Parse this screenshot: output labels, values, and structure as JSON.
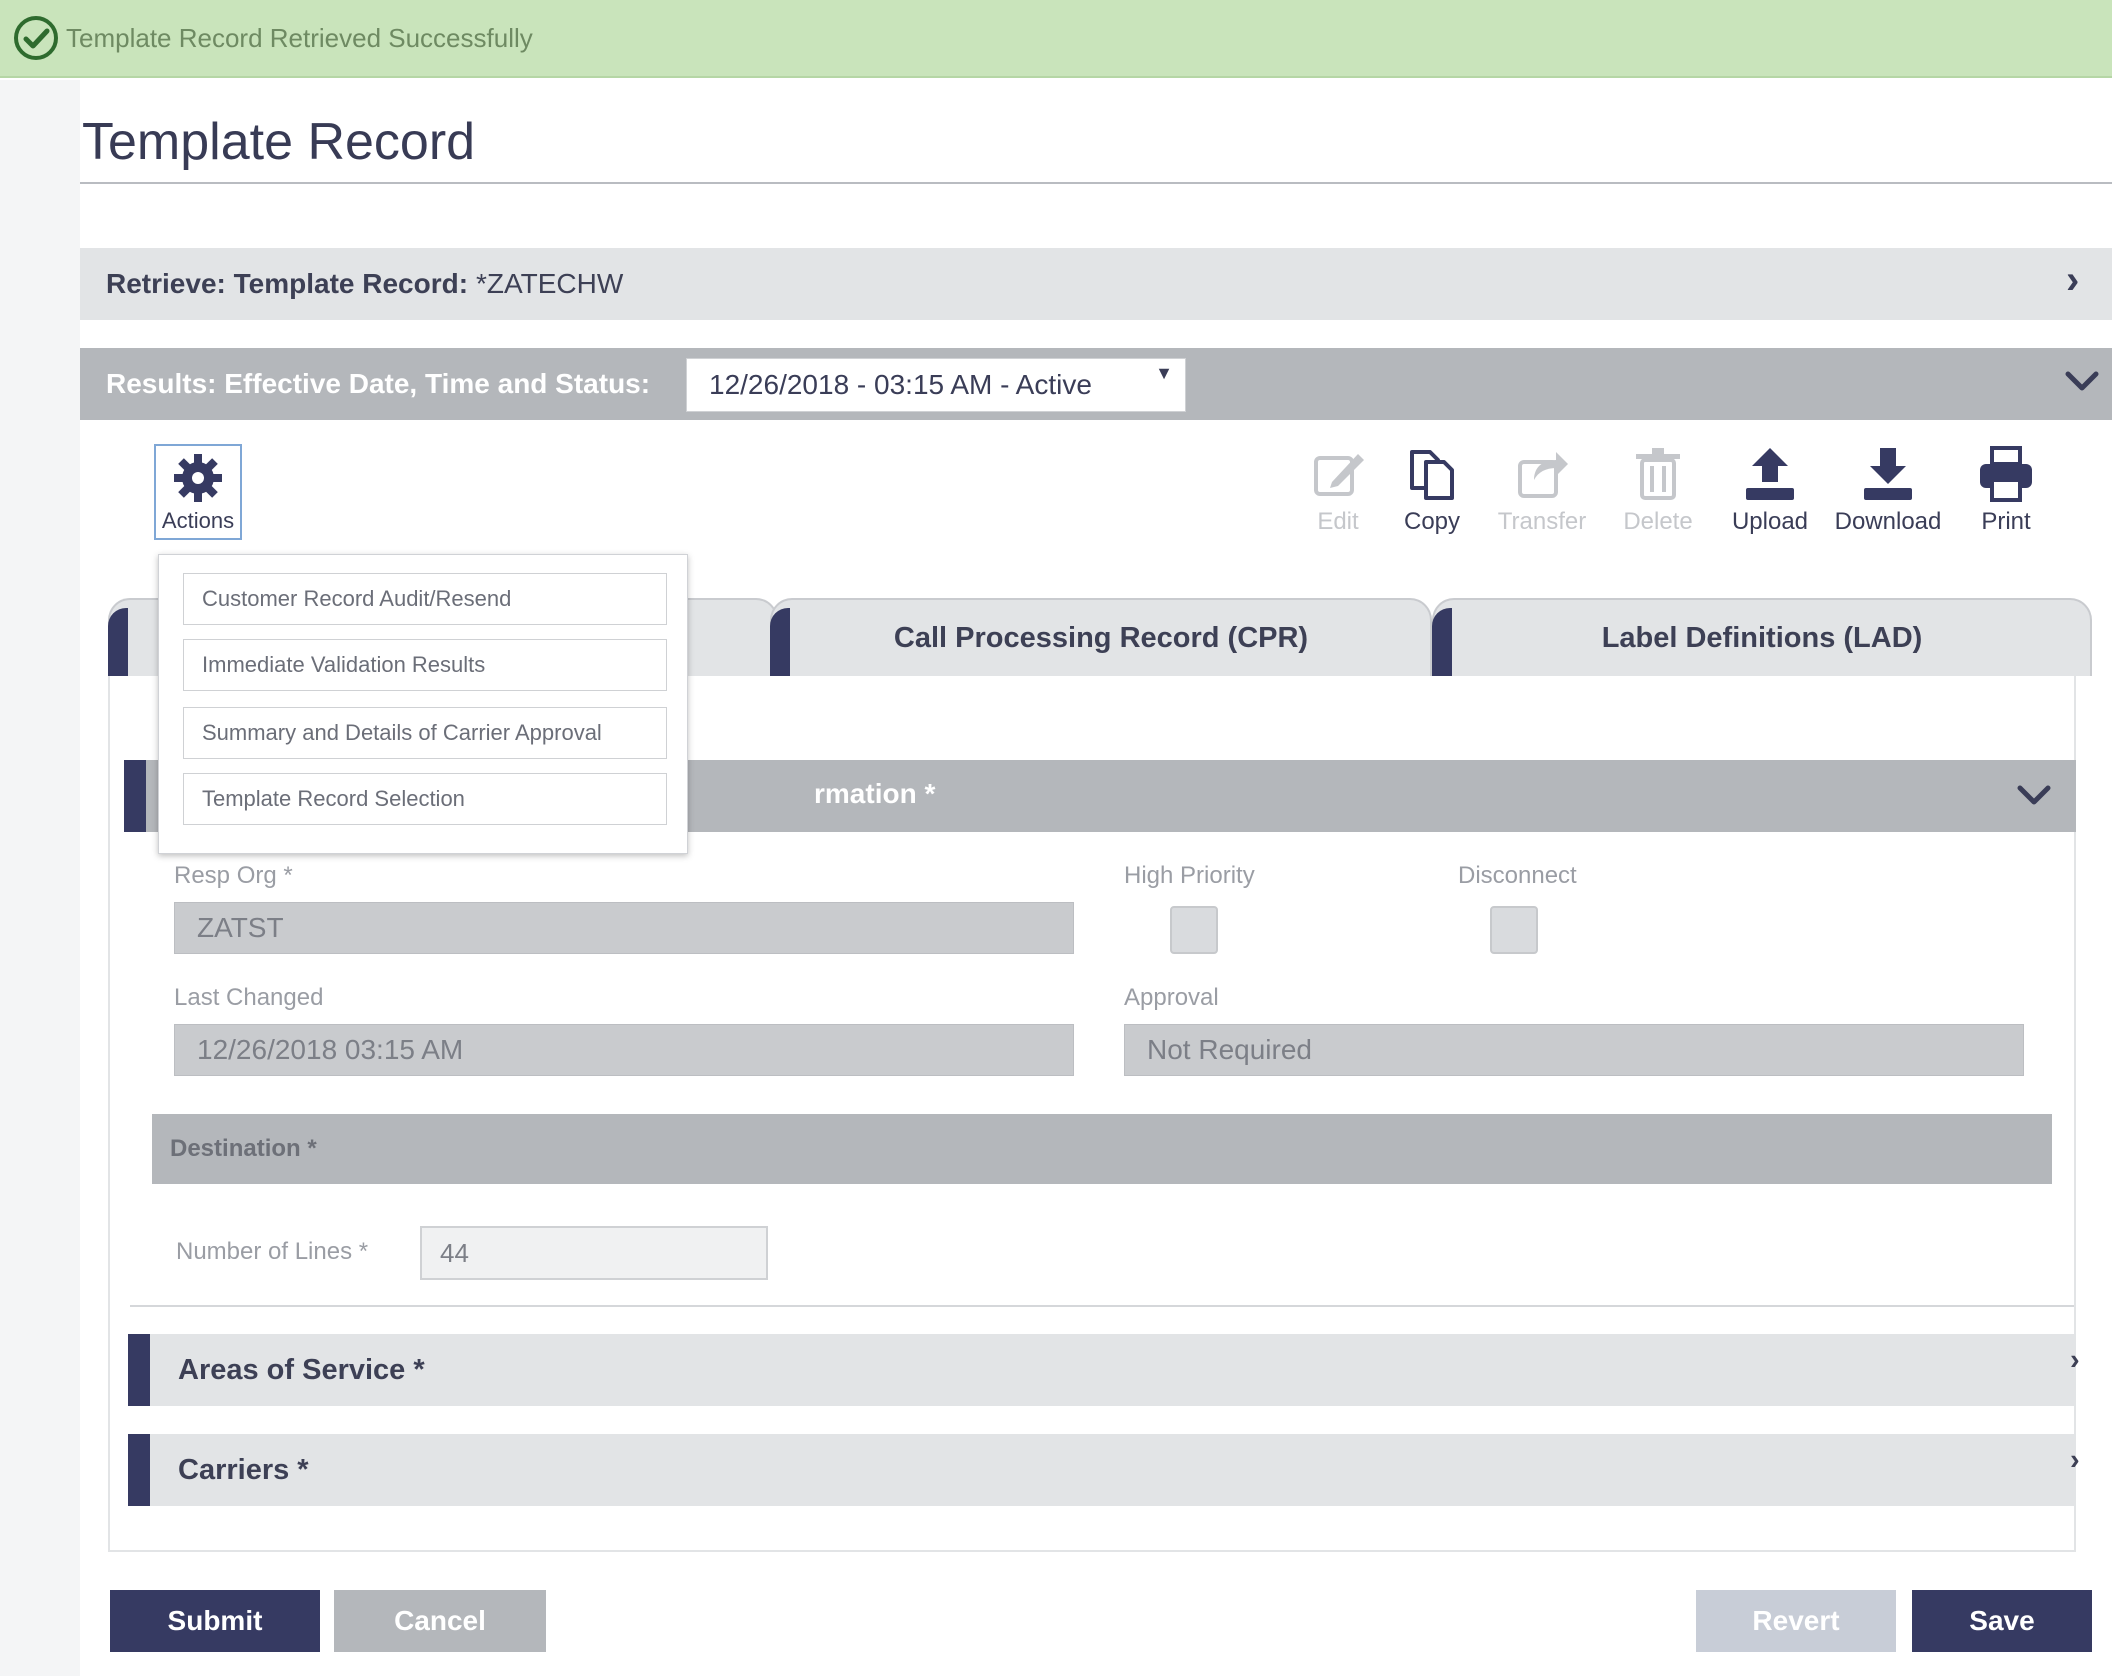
{
  "banner": {
    "message": "Template Record Retrieved Successfully"
  },
  "page": {
    "title": "Template Record"
  },
  "retrieve": {
    "label": "Retrieve: Template Record:",
    "value": "*ZATECHW"
  },
  "results": {
    "label": "Results: Effective Date, Time and Status:",
    "selected": "12/26/2018 - 03:15 AM - Active"
  },
  "actions": {
    "label": "Actions",
    "menu": [
      "Customer Record Audit/Resend",
      "Immediate Validation Results",
      "Summary and Details of Carrier Approval",
      "Template Record Selection"
    ]
  },
  "toolbar": {
    "edit": "Edit",
    "copy": "Copy",
    "transfer": "Transfer",
    "delete": "Delete",
    "upload": "Upload",
    "download": "Download",
    "print": "Print"
  },
  "tabs": {
    "cpr": "Call Processing Record (CPR)",
    "lad": "Label Definitions (LAD)"
  },
  "section": {
    "title_fragment": "rmation *"
  },
  "fields": {
    "resp_org_label": "Resp Org *",
    "resp_org_value": "ZATST",
    "high_priority_label": "High Priority",
    "disconnect_label": "Disconnect",
    "last_changed_label": "Last Changed",
    "last_changed_value": "12/26/2018 03:15 AM",
    "approval_label": "Approval",
    "approval_value": "Not Required"
  },
  "destination": {
    "title": "Destination *",
    "lines_label": "Number of Lines *",
    "lines_value": "44"
  },
  "areas": {
    "title": "Areas of Service *"
  },
  "carriers": {
    "title": "Carriers *"
  },
  "buttons": {
    "submit": "Submit",
    "cancel": "Cancel",
    "revert": "Revert",
    "save": "Save"
  },
  "colors": {
    "navy": "#363a62",
    "banner_green": "#c9e4bb",
    "panel_grey": "#b4b7bb",
    "light_grey": "#e2e4e6",
    "success": "#2e6b2e"
  }
}
